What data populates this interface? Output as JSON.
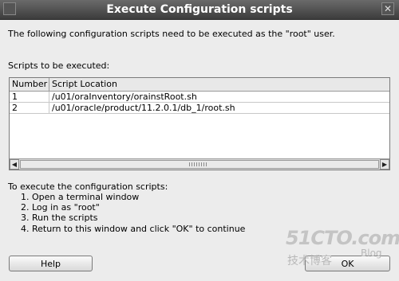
{
  "window": {
    "title": "Execute Configuration scripts",
    "close_glyph": "✕"
  },
  "intro": "The following configuration scripts need to be executed as the \"root\" user.",
  "scripts_label": "Scripts to be executed:",
  "table": {
    "headers": [
      "Number",
      "Script Location"
    ],
    "rows": [
      {
        "number": "1",
        "location": "/u01/oraInventory/orainstRoot.sh"
      },
      {
        "number": "2",
        "location": "/u01/oracle/product/11.2.0.1/db_1/root.sh"
      }
    ]
  },
  "instructions": {
    "heading": "To execute the configuration scripts:",
    "steps": [
      "1. Open a terminal window",
      "2. Log in as \"root\"",
      "3. Run the scripts",
      "4. Return to this window and click \"OK\" to continue"
    ]
  },
  "buttons": {
    "help": "Help",
    "ok": "OK"
  },
  "watermark": {
    "number": "51CTO.com",
    "chinese": "技术博客",
    "blog": "Blog"
  },
  "icons": {
    "scroll_left": "◀",
    "scroll_right": "▶"
  }
}
